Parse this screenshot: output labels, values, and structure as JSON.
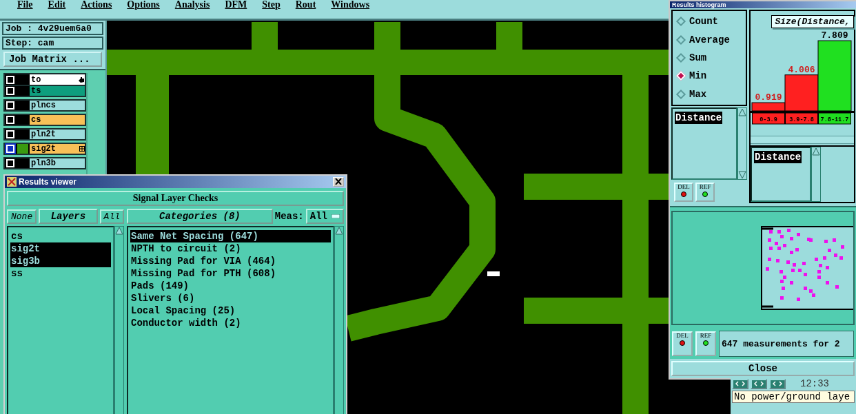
{
  "menu_bar": {
    "items": [
      "File",
      "Edit",
      "Actions",
      "Options",
      "Analysis",
      "DFM",
      "Step",
      "Rout",
      "Windows"
    ]
  },
  "job_panel": {
    "job": "Job : 4v29uem6a0",
    "step": "Step: cam",
    "matrix_button": "Job Matrix ..."
  },
  "layers": [
    {
      "name": "to",
      "color": "#ffffff",
      "work": false,
      "pointer": true,
      "joined": true
    },
    {
      "name": "ts",
      "color": "#0e9e7e",
      "work": false,
      "pointer": false,
      "joined": false
    },
    {
      "name": "plncs",
      "color": "#9cdcdc",
      "work": false,
      "pointer": false,
      "joined": false
    },
    {
      "name": "cs",
      "color": "#f8c058",
      "work": false,
      "pointer": false,
      "joined": false
    },
    {
      "name": "pln2t",
      "color": "#9cdcdc",
      "work": false,
      "pointer": false,
      "joined": false
    },
    {
      "name": "sig2t",
      "color": "#f8c058",
      "work": true,
      "pointer": false,
      "joined": false
    },
    {
      "name": "pln3b",
      "color": "#9cdcdc",
      "work": false,
      "pointer": false,
      "joined": false
    }
  ],
  "results_viewer": {
    "title": "Results viewer",
    "header": "Signal Layer Checks",
    "none_button": "None",
    "layers_label": "Layers",
    "all_button": "All",
    "layer_list": [
      {
        "name": "cs",
        "selected": false
      },
      {
        "name": "sig2t",
        "selected": true
      },
      {
        "name": "sig3b",
        "selected": true
      },
      {
        "name": "ss",
        "selected": false
      }
    ],
    "categories_button": "Categories (8)",
    "meas_label": "Meas:",
    "meas_value": "All",
    "categories": [
      {
        "label": "Same Net Spacing (647)",
        "selected": true
      },
      {
        "label": "NPTH to circuit (2)",
        "selected": false
      },
      {
        "label": "Missing Pad for VIA (464)",
        "selected": false
      },
      {
        "label": "Missing Pad for PTH (608)",
        "selected": false
      },
      {
        "label": "Pads (149)",
        "selected": false
      },
      {
        "label": "Slivers (6)",
        "selected": false
      },
      {
        "label": "Local Spacing (25)",
        "selected": false
      },
      {
        "label": "Conductor width (2)",
        "selected": false
      }
    ]
  },
  "histogram": {
    "title": "Results histogram",
    "modes": [
      {
        "label": "Count",
        "selected": false
      },
      {
        "label": "Average",
        "selected": false
      },
      {
        "label": "Sum",
        "selected": false
      },
      {
        "label": "Min",
        "selected": true
      },
      {
        "label": "Max",
        "selected": false
      }
    ],
    "field_list": [
      "Distance"
    ],
    "del_button": "DEL",
    "ref_button": "REF",
    "chart_data": {
      "type": "bar",
      "title": "Size(Distance,",
      "categories": [
        "0-3.9",
        "3.9-7.8",
        "7.8-11.7"
      ],
      "series": [
        {
          "color": "#ff2020",
          "values": [
            0.919,
            4.006,
            null
          ]
        },
        {
          "color": "#20e020",
          "values": [
            null,
            null,
            7.809
          ]
        }
      ],
      "data_labels": true
    },
    "axis_list": [
      "Distance"
    ],
    "bottom_del": "DEL",
    "bottom_ref": "REF",
    "status": "647 measurements for 2",
    "close_button": "Close"
  },
  "status_panel": {
    "time": "12:33",
    "message": "No power/ground laye"
  }
}
